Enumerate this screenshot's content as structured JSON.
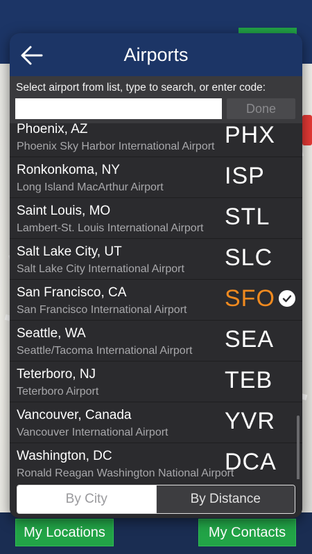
{
  "header": {
    "title": "Airports"
  },
  "search": {
    "hint": "Select airport from list, type to search, or enter code:",
    "value": "",
    "placeholder": "",
    "done_label": "Done"
  },
  "airports": [
    {
      "city": "Phoenix, AZ",
      "airport": "Phoenix Sky Harbor International Airport",
      "code": "PHX",
      "selected": false
    },
    {
      "city": "Ronkonkoma, NY",
      "airport": "Long Island MacArthur Airport",
      "code": "ISP",
      "selected": false
    },
    {
      "city": "Saint Louis, MO",
      "airport": "Lambert-St. Louis International Airport",
      "code": "STL",
      "selected": false
    },
    {
      "city": "Salt Lake City, UT",
      "airport": "Salt Lake City International Airport",
      "code": "SLC",
      "selected": false
    },
    {
      "city": "San Francisco, CA",
      "airport": "San Francisco International Airport",
      "code": "SFO",
      "selected": true
    },
    {
      "city": "Seattle, WA",
      "airport": "Seattle/Tacoma International Airport",
      "code": "SEA",
      "selected": false
    },
    {
      "city": "Teterboro, NJ",
      "airport": "Teterboro Airport",
      "code": "TEB",
      "selected": false
    },
    {
      "city": "Vancouver, Canada",
      "airport": "Vancouver International Airport",
      "code": "YVR",
      "selected": false
    },
    {
      "city": "Washington, DC",
      "airport": "Ronald Reagan Washington National Airport",
      "code": "DCA",
      "selected": false
    }
  ],
  "segments": {
    "by_city": "By City",
    "by_distance": "By Distance",
    "active": "by_city"
  },
  "background": {
    "left_button": "My Locations",
    "right_button": "My Contacts"
  },
  "colors": {
    "header": "#1c3566",
    "selected_code": "#f08a1f",
    "green": "#22a447"
  }
}
